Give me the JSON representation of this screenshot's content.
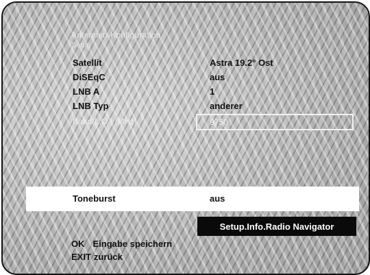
{
  "menu": {
    "title": "Antennen-Konfiguration",
    "subtitle": "Setup"
  },
  "settings": [
    {
      "label": "Satellit",
      "value": "Astra 19.2° Ost"
    },
    {
      "label": "DiSEqC",
      "value": "aus"
    },
    {
      "label": "LNB A",
      "value": "1"
    },
    {
      "label": "LNB Typ",
      "value": "anderer"
    }
  ],
  "band_field": {
    "label": "Band(L.O.) [MHz]",
    "value": "9750"
  },
  "toneburst": {
    "label": "Toneburst",
    "value": "aus"
  },
  "nav_badge": "Setup.Info.Radio Navigator",
  "hints": [
    {
      "key": "OK",
      "desc": "Eingabe speichern"
    },
    {
      "key": "EXIT",
      "desc": "zurück"
    }
  ]
}
